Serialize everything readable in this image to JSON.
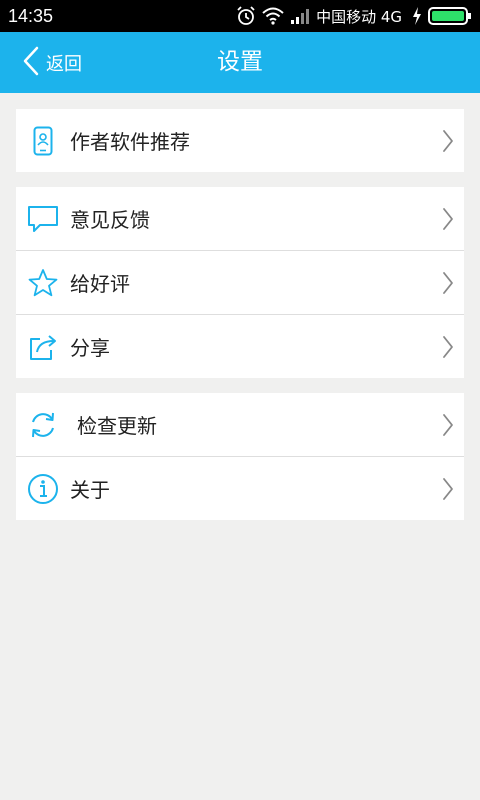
{
  "status_bar": {
    "time": "14:35",
    "carrier": "中国移动 4G",
    "icons": [
      "alarm-icon",
      "wifi-icon",
      "signal-icon",
      "charging-icon",
      "battery-icon"
    ]
  },
  "header": {
    "back_label": "返回",
    "title": "设置"
  },
  "colors": {
    "accent": "#1cb3ec",
    "background": "#f0f0ef",
    "battery": "#2ee06a"
  },
  "groups": [
    {
      "items": [
        {
          "label": "作者软件推荐",
          "icon": "phone-person-icon"
        }
      ]
    },
    {
      "items": [
        {
          "label": "意见反馈",
          "icon": "chat-bubble-icon"
        },
        {
          "label": "给好评",
          "icon": "star-icon"
        },
        {
          "label": "分享",
          "icon": "share-icon"
        }
      ]
    },
    {
      "items": [
        {
          "label": "检查更新",
          "icon": "refresh-icon"
        },
        {
          "label": "关于",
          "icon": "info-icon"
        }
      ]
    }
  ]
}
